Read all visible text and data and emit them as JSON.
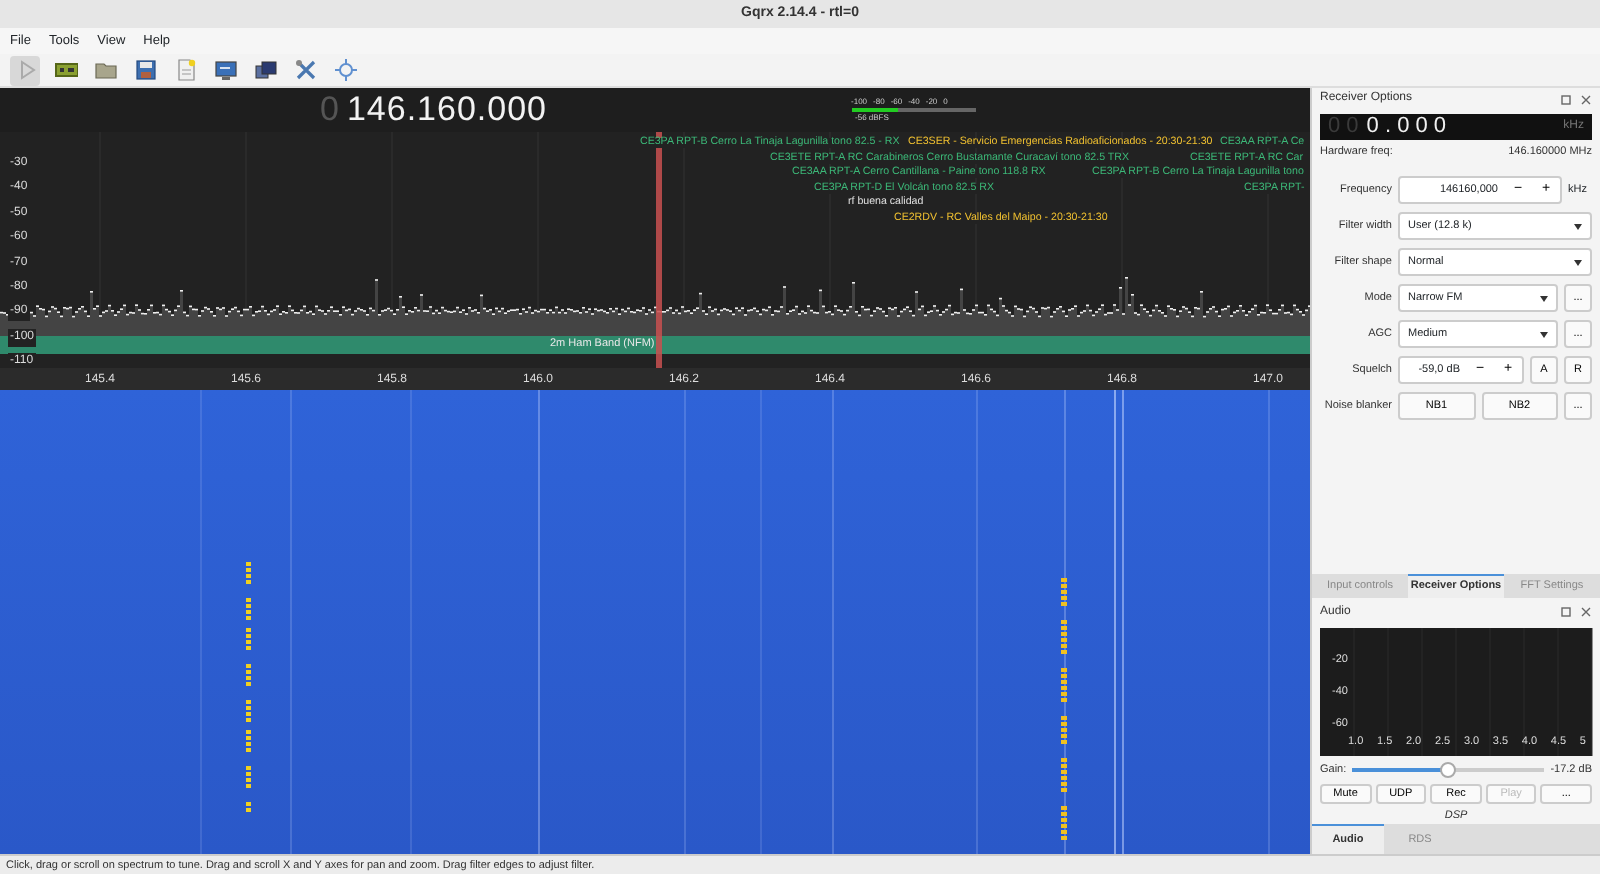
{
  "window": {
    "title": "Gqrx 2.14.4 - rtl=0"
  },
  "menu": [
    "File",
    "Tools",
    "View",
    "Help"
  ],
  "toolbar": [
    {
      "kind": "play",
      "pressed": true
    },
    {
      "kind": "device",
      "pressed": false
    },
    {
      "kind": "folder",
      "pressed": false
    },
    {
      "kind": "save",
      "pressed": false
    },
    {
      "kind": "document",
      "pressed": false
    },
    {
      "kind": "monitor",
      "pressed": false
    },
    {
      "kind": "windows",
      "pressed": false
    },
    {
      "kind": "tools",
      "pressed": false
    },
    {
      "kind": "crosshair",
      "pressed": false
    }
  ],
  "spectrum": {
    "readout_dim": "0",
    "readout": "146.160.000",
    "meter": {
      "scale": [
        "-100",
        "-80",
        "-60",
        "-40",
        "-20",
        "0"
      ],
      "level": 0.38,
      "reading": "-56 dBFS"
    },
    "y_labels": [
      "-30",
      "-40",
      "-50",
      "-60",
      "-70",
      "-80",
      "-90",
      "-100",
      "-110"
    ],
    "x_labels": [
      "145.4",
      "145.6",
      "145.8",
      "146.0",
      "146.2",
      "146.4",
      "146.6",
      "146.8",
      "147.0"
    ],
    "band": "2m Ham Band (NFM)",
    "bookmarks": [
      {
        "label": "CE3PA RPT-B Cerro La Tinaja Lagunilla tono 82.5 - RX",
        "color": "#3cb878"
      },
      {
        "label": "CE3SER - Servicio Emergencias Radioaficionados - 20:30-21:30",
        "color": "#f0c030"
      },
      {
        "label": "CE3AA RPT-A Ce",
        "color": "#3cb878"
      },
      {
        "label": "CE3ETE RPT-A RC Carabineros Cerro Bustamante Curacaví tono 82.5 TRX",
        "color": "#3cb878"
      },
      {
        "label": "CE3ETE RPT-A RC Car",
        "color": "#3cb878"
      },
      {
        "label": "CE3AA RPT-A Cerro Cantillana - Paine tono 118.8 RX",
        "color": "#3cb878"
      },
      {
        "label": "CE3PA RPT-B Cerro La Tinaja Lagunilla tono",
        "color": "#3cb878"
      },
      {
        "label": "CE3PA RPT-D El Volcán tono 82.5 RX",
        "color": "#3cb878"
      },
      {
        "label": "CE3PA RPT-",
        "color": "#3cb878"
      },
      {
        "label": "rf buena calidad",
        "color": "#e0e0e0"
      },
      {
        "label": "CE2RDV - RC Valles del Maipo - 20:30-21:30",
        "color": "#f0c030"
      }
    ]
  },
  "receiver_options": {
    "title": "Receiver Options",
    "lcd_dim": "0 0",
    "lcd": "0 . 0 0 0",
    "lcd_unit": "kHz",
    "hardware_label": "Hardware freq:",
    "hardware_value": "146.160000 MHz",
    "rows": [
      {
        "kind": "spin",
        "label": "Frequency",
        "value": "146160,000",
        "steps": [
          "−",
          "+"
        ],
        "unit": "kHz"
      },
      {
        "kind": "combo",
        "label": "Filter width",
        "value": "User (12.8 k)"
      },
      {
        "kind": "combo",
        "label": "Filter shape",
        "value": "Normal"
      },
      {
        "kind": "combo",
        "label": "Mode",
        "value": "Narrow FM",
        "extra": "..."
      },
      {
        "kind": "combo",
        "label": "AGC",
        "value": "Medium",
        "extra": "..."
      },
      {
        "kind": "spin",
        "label": "Squelch",
        "value": "-59,0 dB",
        "steps": [
          "−",
          "+"
        ],
        "buttons": [
          "A",
          "R"
        ]
      },
      {
        "kind": "buttons",
        "label": "Noise blanker",
        "buttons": [
          "NB1",
          "NB2"
        ],
        "extra": "..."
      }
    ]
  },
  "dock_tabs": [
    {
      "label": "Input controls",
      "selected": false
    },
    {
      "label": "Receiver Options",
      "selected": true
    },
    {
      "label": "FFT Settings",
      "selected": false
    }
  ],
  "audio": {
    "title": "Audio",
    "y_labels": [
      "-20",
      "-40",
      "-60"
    ],
    "x_labels": [
      "1.0",
      "1.5",
      "2.0",
      "2.5",
      "3.0",
      "3.5",
      "4.0",
      "4.5",
      "5"
    ],
    "gain_label": "Gain:",
    "gain": {
      "level": 0.5
    },
    "gain_reading": "-17.2 dB",
    "buttons": [
      {
        "label": "Mute",
        "disabled": false
      },
      {
        "label": "UDP",
        "disabled": false
      },
      {
        "label": "Rec",
        "disabled": false
      },
      {
        "label": "Play",
        "disabled": true
      },
      {
        "label": "...",
        "disabled": false
      }
    ],
    "dsp": "DSP"
  },
  "bottom_tabs": [
    {
      "label": "Audio",
      "selected": true
    },
    {
      "label": "RDS",
      "selected": false
    }
  ],
  "status_bar": "Click, drag or scroll on spectrum to tune. Drag and scroll X and Y axes for pan and zoom. Drag filter edges to adjust filter."
}
